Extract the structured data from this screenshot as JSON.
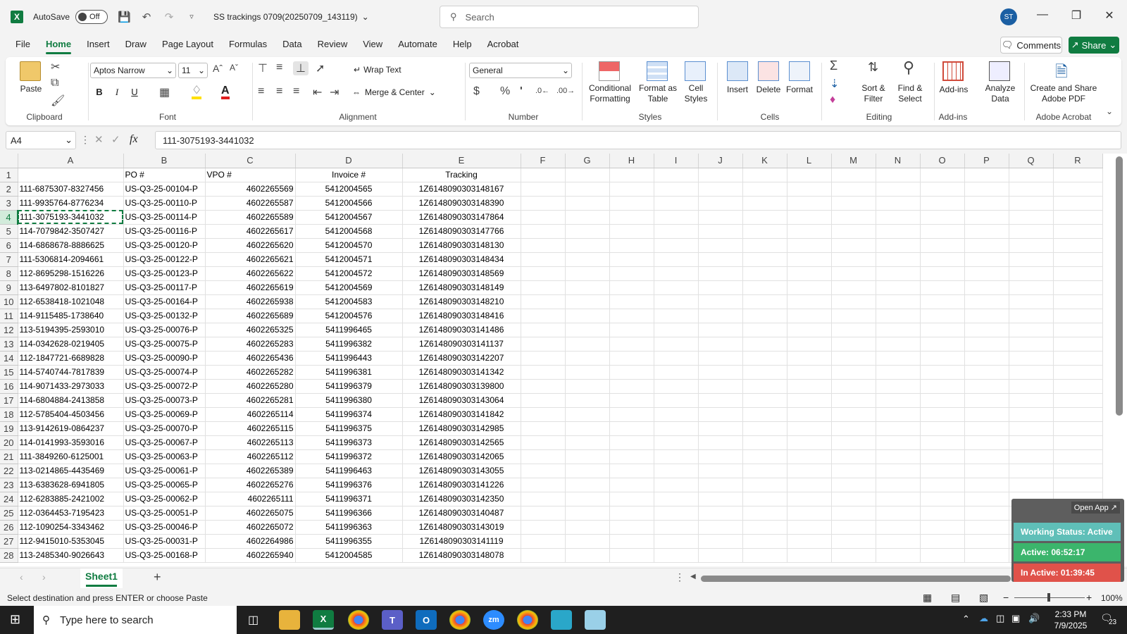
{
  "app": {
    "autosave_label": "AutoSave",
    "autosave_state": "Off",
    "doc_title": "SS trackings 0709(20250709_143119)",
    "search_placeholder": "Search",
    "user_initials": "ST"
  },
  "menu": [
    "File",
    "Home",
    "Insert",
    "Draw",
    "Page Layout",
    "Formulas",
    "Data",
    "Review",
    "View",
    "Automate",
    "Help",
    "Acrobat"
  ],
  "menu_active": "Home",
  "header_buttons": {
    "comments": "Comments",
    "share": "Share"
  },
  "ribbon": {
    "clipboard": {
      "label": "Clipboard",
      "paste": "Paste"
    },
    "font": {
      "label": "Font",
      "name": "Aptos Narrow",
      "size": "11",
      "bold": "B",
      "italic": "I",
      "underline": "U"
    },
    "alignment": {
      "label": "Alignment",
      "wrap": "Wrap Text",
      "merge": "Merge & Center"
    },
    "number": {
      "label": "Number",
      "format": "General"
    },
    "styles": {
      "label": "Styles",
      "conditional_1": "Conditional",
      "conditional_2": "Formatting",
      "format_table_1": "Format as",
      "format_table_2": "Table",
      "cell_styles_1": "Cell",
      "cell_styles_2": "Styles"
    },
    "cells": {
      "label": "Cells",
      "insert": "Insert",
      "delete": "Delete",
      "format": "Format"
    },
    "editing": {
      "label": "Editing",
      "sort_1": "Sort &",
      "sort_2": "Filter",
      "find_1": "Find &",
      "find_2": "Select"
    },
    "addins": {
      "label": "Add-ins",
      "addins": "Add-ins",
      "analyze_1": "Analyze",
      "analyze_2": "Data"
    },
    "acrobat": {
      "label": "Adobe Acrobat",
      "create_1": "Create and Share",
      "create_2": "Adobe PDF"
    }
  },
  "formula": {
    "name_box": "A4",
    "fx": "fx",
    "content": "111-3075193-3441032"
  },
  "columns": [
    "A",
    "B",
    "C",
    "D",
    "E",
    "F",
    "G",
    "H",
    "I",
    "J",
    "K",
    "L",
    "M",
    "N",
    "O",
    "P",
    "Q",
    "R"
  ],
  "header_row": [
    "",
    "PO #",
    "VPO #",
    "Invoice #",
    "Tracking"
  ],
  "rows": [
    [
      "111-6875307-8327456",
      "US-Q3-25-00104-P",
      "4602265569",
      "5412004565",
      "1Z6148090303148167"
    ],
    [
      "111-9935764-8776234",
      "US-Q3-25-00110-P",
      "4602265587",
      "5412004566",
      "1Z6148090303148390"
    ],
    [
      "111-3075193-3441032",
      "US-Q3-25-00114-P",
      "4602265589",
      "5412004567",
      "1Z6148090303147864"
    ],
    [
      "114-7079842-3507427",
      "US-Q3-25-00116-P",
      "4602265617",
      "5412004568",
      "1Z6148090303147766"
    ],
    [
      "114-6868678-8886625",
      "US-Q3-25-00120-P",
      "4602265620",
      "5412004570",
      "1Z6148090303148130"
    ],
    [
      "111-5306814-2094661",
      "US-Q3-25-00122-P",
      "4602265621",
      "5412004571",
      "1Z6148090303148434"
    ],
    [
      "112-8695298-1516226",
      "US-Q3-25-00123-P",
      "4602265622",
      "5412004572",
      "1Z6148090303148569"
    ],
    [
      "113-6497802-8101827",
      "US-Q3-25-00117-P",
      "4602265619",
      "5412004569",
      "1Z6148090303148149"
    ],
    [
      "112-6538418-1021048",
      "US-Q3-25-00164-P",
      "4602265938",
      "5412004583",
      "1Z6148090303148210"
    ],
    [
      "114-9115485-1738640",
      "US-Q3-25-00132-P",
      "4602265689",
      "5412004576",
      "1Z6148090303148416"
    ],
    [
      "113-5194395-2593010",
      "US-Q3-25-00076-P",
      "4602265325",
      "5411996465",
      "1Z6148090303141486"
    ],
    [
      "114-0342628-0219405",
      "US-Q3-25-00075-P",
      "4602265283",
      "5411996382",
      "1Z6148090303141137"
    ],
    [
      "112-1847721-6689828",
      "US-Q3-25-00090-P",
      "4602265436",
      "5411996443",
      "1Z6148090303142207"
    ],
    [
      "114-5740744-7817839",
      "US-Q3-25-00074-P",
      "4602265282",
      "5411996381",
      "1Z6148090303141342"
    ],
    [
      "114-9071433-2973033",
      "US-Q3-25-00072-P",
      "4602265280",
      "5411996379",
      "1Z6148090303139800"
    ],
    [
      "114-6804884-2413858",
      "US-Q3-25-00073-P",
      "4602265281",
      "5411996380",
      "1Z6148090303143064"
    ],
    [
      "112-5785404-4503456",
      "US-Q3-25-00069-P",
      "4602265114",
      "5411996374",
      "1Z6148090303141842"
    ],
    [
      "113-9142619-0864237",
      "US-Q3-25-00070-P",
      "4602265115",
      "5411996375",
      "1Z6148090303142985"
    ],
    [
      "114-0141993-3593016",
      "US-Q3-25-00067-P",
      "4602265113",
      "5411996373",
      "1Z6148090303142565"
    ],
    [
      "111-3849260-6125001",
      "US-Q3-25-00063-P",
      "4602265112",
      "5411996372",
      "1Z6148090303142065"
    ],
    [
      "113-0214865-4435469",
      "US-Q3-25-00061-P",
      "4602265389",
      "5411996463",
      "1Z6148090303143055"
    ],
    [
      "113-6383628-6941805",
      "US-Q3-25-00065-P",
      "4602265276",
      "5411996376",
      "1Z6148090303141226"
    ],
    [
      "112-6283885-2421002",
      "US-Q3-25-00062-P",
      "4602265111",
      "5411996371",
      "1Z6148090303142350"
    ],
    [
      "112-0364453-7195423",
      "US-Q3-25-00051-P",
      "4602265075",
      "5411996366",
      "1Z6148090303140487"
    ],
    [
      "112-1090254-3343462",
      "US-Q3-25-00046-P",
      "4602265072",
      "5411996363",
      "1Z6148090303143019"
    ],
    [
      "112-9415010-5353045",
      "US-Q3-25-00031-P",
      "4602264986",
      "5411996355",
      "1Z6148090303141119"
    ],
    [
      "113-2485340-9026643",
      "US-Q3-25-00168-P",
      "4602265940",
      "5412004585",
      "1Z6148090303148078"
    ]
  ],
  "active_row": 4,
  "sheet": {
    "tab": "Sheet1",
    "add": "+"
  },
  "status": {
    "message": "Select destination and press ENTER or choose Paste",
    "zoom": "100%"
  },
  "widget": {
    "open_app": "Open App ↗",
    "working": "Working Status: Active",
    "active": "Active: 06:52:17",
    "inactive": "In Active: 01:39:45"
  },
  "taskbar": {
    "search": "Type here to search",
    "time": "2:33 PM",
    "date": "7/9/2025",
    "notif": "23"
  },
  "colors": {
    "excel_green": "#107c41",
    "widget_teal": "#5fbfb8",
    "widget_green": "#3bb56c",
    "widget_red": "#e0524a"
  }
}
